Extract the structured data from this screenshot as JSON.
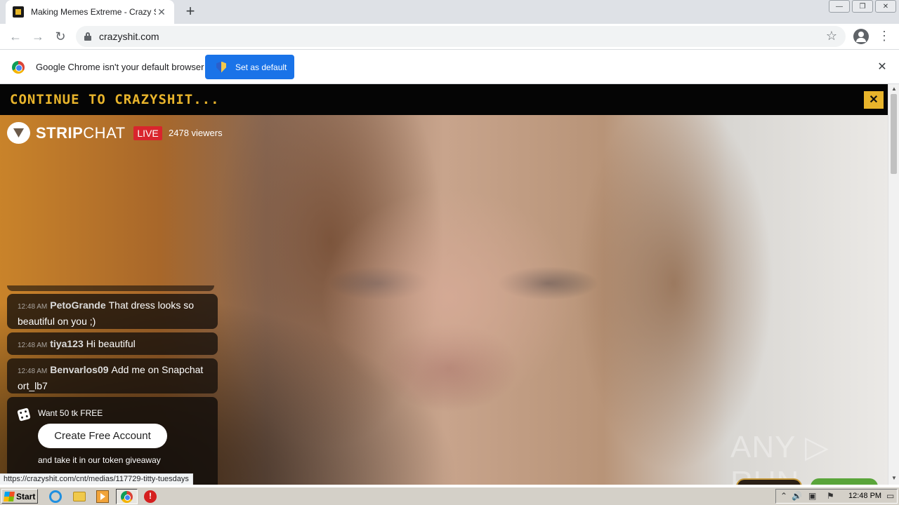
{
  "browser": {
    "tab_title": "Making Memes Extreme - Crazy Shit",
    "tab_close": "✕",
    "new_tab": "+",
    "url": "crazyshit.com",
    "back": "←",
    "forward": "→",
    "reload": "↻",
    "bookmark": "☆",
    "menu": "⋮",
    "window_controls": [
      "—",
      "❐",
      "✕"
    ]
  },
  "infobar": {
    "message": "Google Chrome isn't your default browser",
    "button_label": "Set as default",
    "close": "✕"
  },
  "page": {
    "banner_text": "CONTINUE TO CRAZYSHIT...",
    "banner_close": "✕",
    "logo_strip": "STRIP",
    "logo_chat": "CHAT",
    "live_label": "LIVE",
    "viewers": "2478 viewers",
    "chat": [
      {
        "time": "12:48 AM",
        "user": "PetoGrande",
        "text": "That dress looks so beautiful on you ;)"
      },
      {
        "time": "12:48 AM",
        "user": "tiya123",
        "text": "Hi beautiful"
      },
      {
        "time": "12:48 AM",
        "user": "Benvarlos09",
        "text": "Add me on Snapchat ort_lb7"
      }
    ],
    "promo": {
      "title": "Want 50 tk FREE",
      "button": "Create Free Account",
      "subtitle": "and take it in our token giveaway"
    },
    "watermark": "ANY ▷ RUN",
    "status_url": "https://crazyshit.com/cnt/medias/117729-titty-tuesdays"
  },
  "taskbar": {
    "start_label": "Start",
    "clock": "12:48 PM",
    "tray_glyphs": [
      "⌃",
      "🔊",
      "▣",
      "⚑",
      "▭"
    ]
  },
  "colors": {
    "banner_accent": "#e8b42b",
    "live_red": "#d9252d",
    "chrome_blue": "#1a73e8"
  }
}
